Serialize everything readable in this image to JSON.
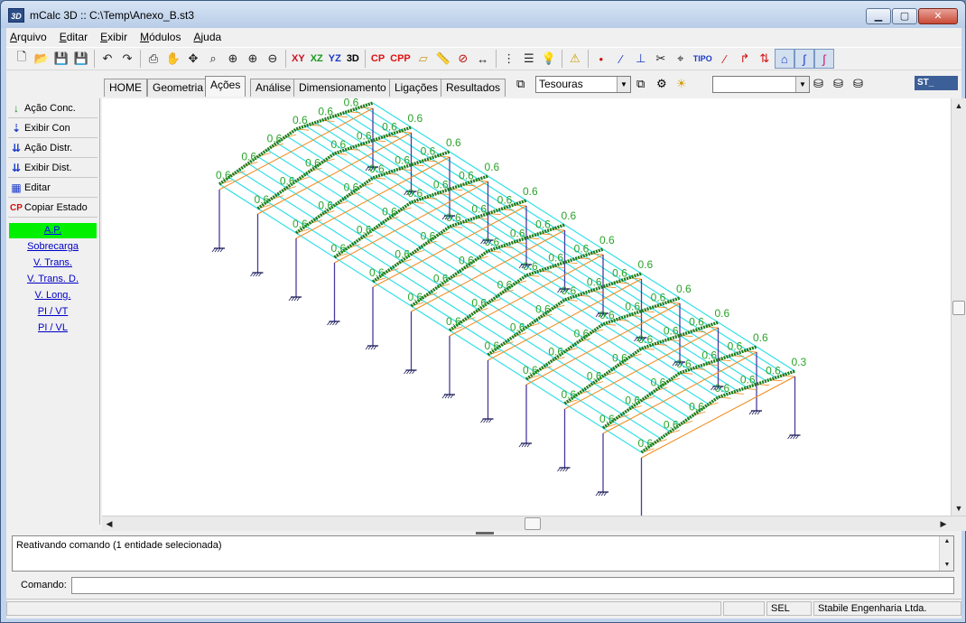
{
  "window": {
    "app_icon_text": "3D",
    "title": "mCalc 3D :: C:\\Temp\\Anexo_B.st3",
    "minimize": "▁",
    "maximize": "▢",
    "close": "✕"
  },
  "menu": [
    "Arquivo",
    "Editar",
    "Exibir",
    "Módulos",
    "Ajuda"
  ],
  "toolbar": {
    "view_xy": "XY",
    "view_xz": "XZ",
    "view_yz": "YZ",
    "view_3d": "3D",
    "cp": "CP",
    "cpp": "CPP"
  },
  "tabs": [
    "HOME",
    "Geometria",
    "Ações",
    "Análise",
    "Dimensionamento",
    "Ligações",
    "Resultados"
  ],
  "active_tab": "Ações",
  "layer_combo": {
    "value": "Tesouras"
  },
  "second_combo": {
    "value": ""
  },
  "brand_logo": "ST_",
  "left_panel": {
    "buttons": [
      {
        "icon": "↓",
        "label": "Ação Conc."
      },
      {
        "icon": "⇣",
        "label": "Exibir Con"
      },
      {
        "icon": "⇊",
        "label": "Ação Distr."
      },
      {
        "icon": "⇊",
        "label": "Exibir Dist."
      },
      {
        "icon": "▦",
        "label": "Editar"
      },
      {
        "icon": "CP",
        "label": "Copiar Estado"
      }
    ],
    "load_cases": [
      "A.P.",
      "Sobrecarga",
      "V. Trans.",
      "V. Trans. D.",
      "V. Long.",
      "PI / VT",
      "PI / VL"
    ],
    "active_case": "A.P."
  },
  "viewport": {
    "load_label": "0.6",
    "load_label_small": "0.3",
    "colors": {
      "purlin": "#33e0e8",
      "truss": "#f08a1a",
      "column": "#4b3b9e",
      "load": "#1a7a1a",
      "label": "#2aa32a"
    }
  },
  "message": "Reativando comando (1 entidade selecionada)",
  "command": {
    "label": "Comando:",
    "value": ""
  },
  "status": {
    "sel": "SEL",
    "company": "Stabile Engenharia Ltda."
  }
}
